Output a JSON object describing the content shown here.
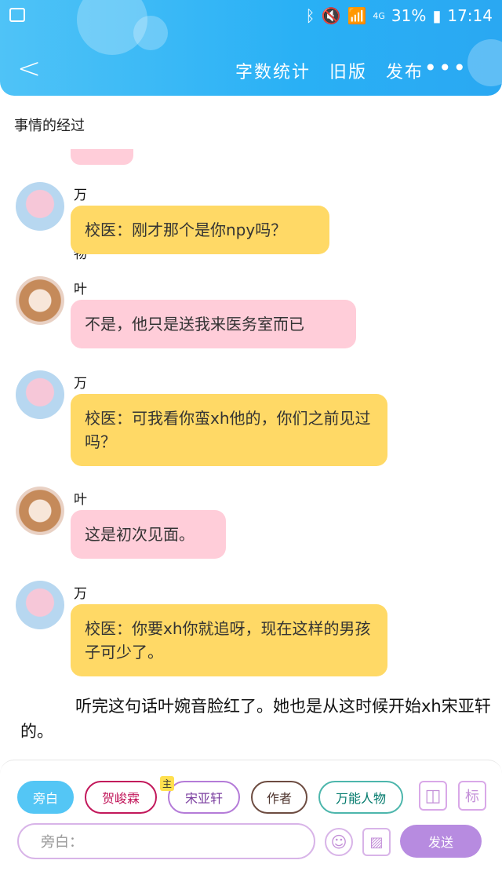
{
  "status": {
    "battery": "31%",
    "time": "17:14",
    "network": "4G"
  },
  "nav": {
    "back": "<",
    "word_count": "字数统计",
    "old_version": "旧版",
    "publish": "发布",
    "more": "•••"
  },
  "doc_title": "事情的经过",
  "messages": [
    {
      "name": "万能人物",
      "text": "校医：刚才那个是你npy吗？"
    },
    {
      "name": "叶婉音",
      "text": "不是，他只是送我来医务室而已"
    },
    {
      "name": "万能人物",
      "text": "校医：可我看你蛮xh他的，你们之前见过吗？"
    },
    {
      "name": "叶婉音",
      "text": "这是初次见面。"
    },
    {
      "name": "万能人物",
      "text": "校医：你要xh你就追呀，现在这样的男孩子可少了。"
    }
  ],
  "narration": "听完这句话叶婉音脸红了。她也是从这时候开始xh宋亚轩的。",
  "toolbar": {
    "chips": [
      "旁白",
      "贺峻霖",
      "宋亚轩",
      "作者",
      "万能人物"
    ],
    "main_tag": "主",
    "mark_label": "标",
    "input_placeholder": "旁白：",
    "send": "发送"
  },
  "colors": {
    "header": "#29b0f5",
    "yellow_bubble": "#ffd966",
    "pink_bubble": "#ffcdd9",
    "send": "#b78be0"
  }
}
